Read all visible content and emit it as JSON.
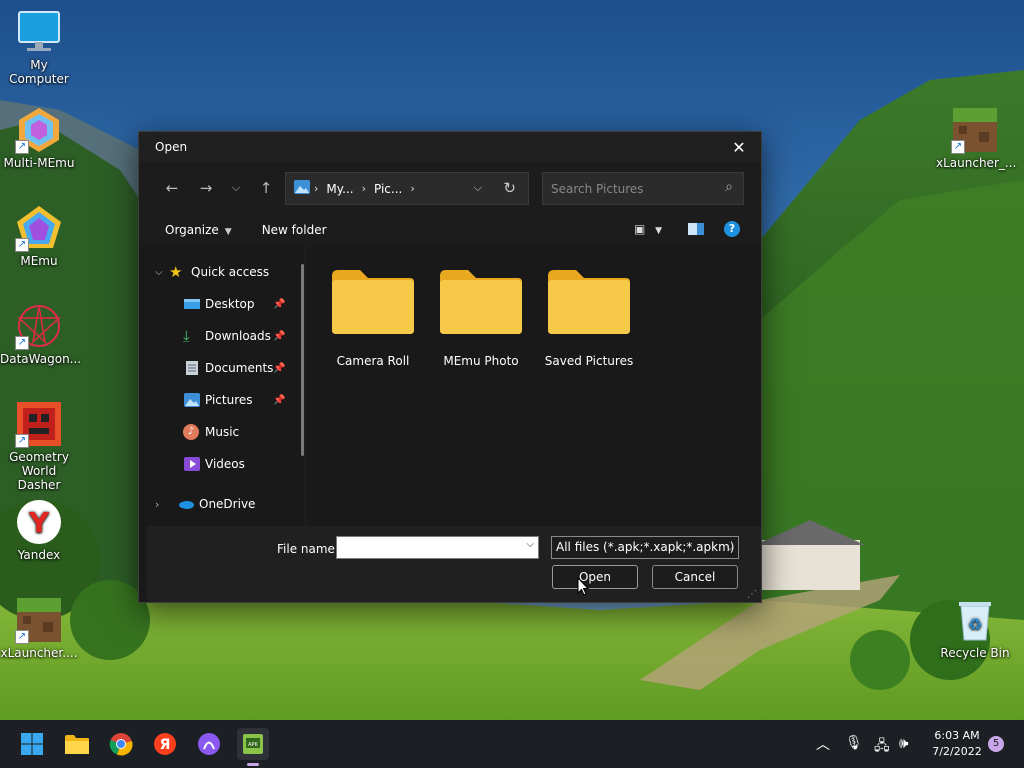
{
  "desktop": {
    "icons_left": [
      {
        "label": "My Computer"
      },
      {
        "label": "Multi-MEmu"
      },
      {
        "label": "MEmu"
      },
      {
        "label": "DataWagon..."
      },
      {
        "label": "Geometry World Dasher"
      },
      {
        "label": "Yandex"
      },
      {
        "label": "xLauncher...."
      }
    ],
    "icons_right": [
      {
        "label": "xLauncher_..."
      },
      {
        "label": "Recycle Bin"
      }
    ]
  },
  "dialog": {
    "title": "Open",
    "close_glyph": "✕",
    "address": {
      "crumbs": [
        "My...",
        "Pic..."
      ],
      "separator": "›"
    },
    "search": {
      "placeholder": "Search Pictures"
    },
    "toolbar": {
      "organize_label": "Organize",
      "new_folder_label": "New folder"
    },
    "sidebar": {
      "items": [
        {
          "label": "Quick access",
          "pinned": false
        },
        {
          "label": "Desktop",
          "pinned": true
        },
        {
          "label": "Downloads",
          "pinned": true
        },
        {
          "label": "Documents",
          "pinned": true
        },
        {
          "label": "Pictures",
          "pinned": true
        },
        {
          "label": "Music",
          "pinned": false
        },
        {
          "label": "Videos",
          "pinned": false
        },
        {
          "label": "OneDrive",
          "pinned": false
        }
      ]
    },
    "folders": [
      {
        "name": "Camera Roll"
      },
      {
        "name": "MEmu Photo"
      },
      {
        "name": "Saved Pictures"
      }
    ],
    "footer": {
      "file_name_label": "File name:",
      "file_name_value": "",
      "filter_value": "All files (*.apk;*.xapk;*.apkm)",
      "open_label": "Open",
      "cancel_label": "Cancel"
    }
  },
  "taskbar": {
    "time": "6:03 AM",
    "date": "7/2/2022",
    "notification_count": "5"
  },
  "colors": {
    "dialog_bg": "#191919",
    "accent": "#1e90e0",
    "folder_yellow": "#f7c948",
    "taskbar_bg": "#1c1f24"
  }
}
